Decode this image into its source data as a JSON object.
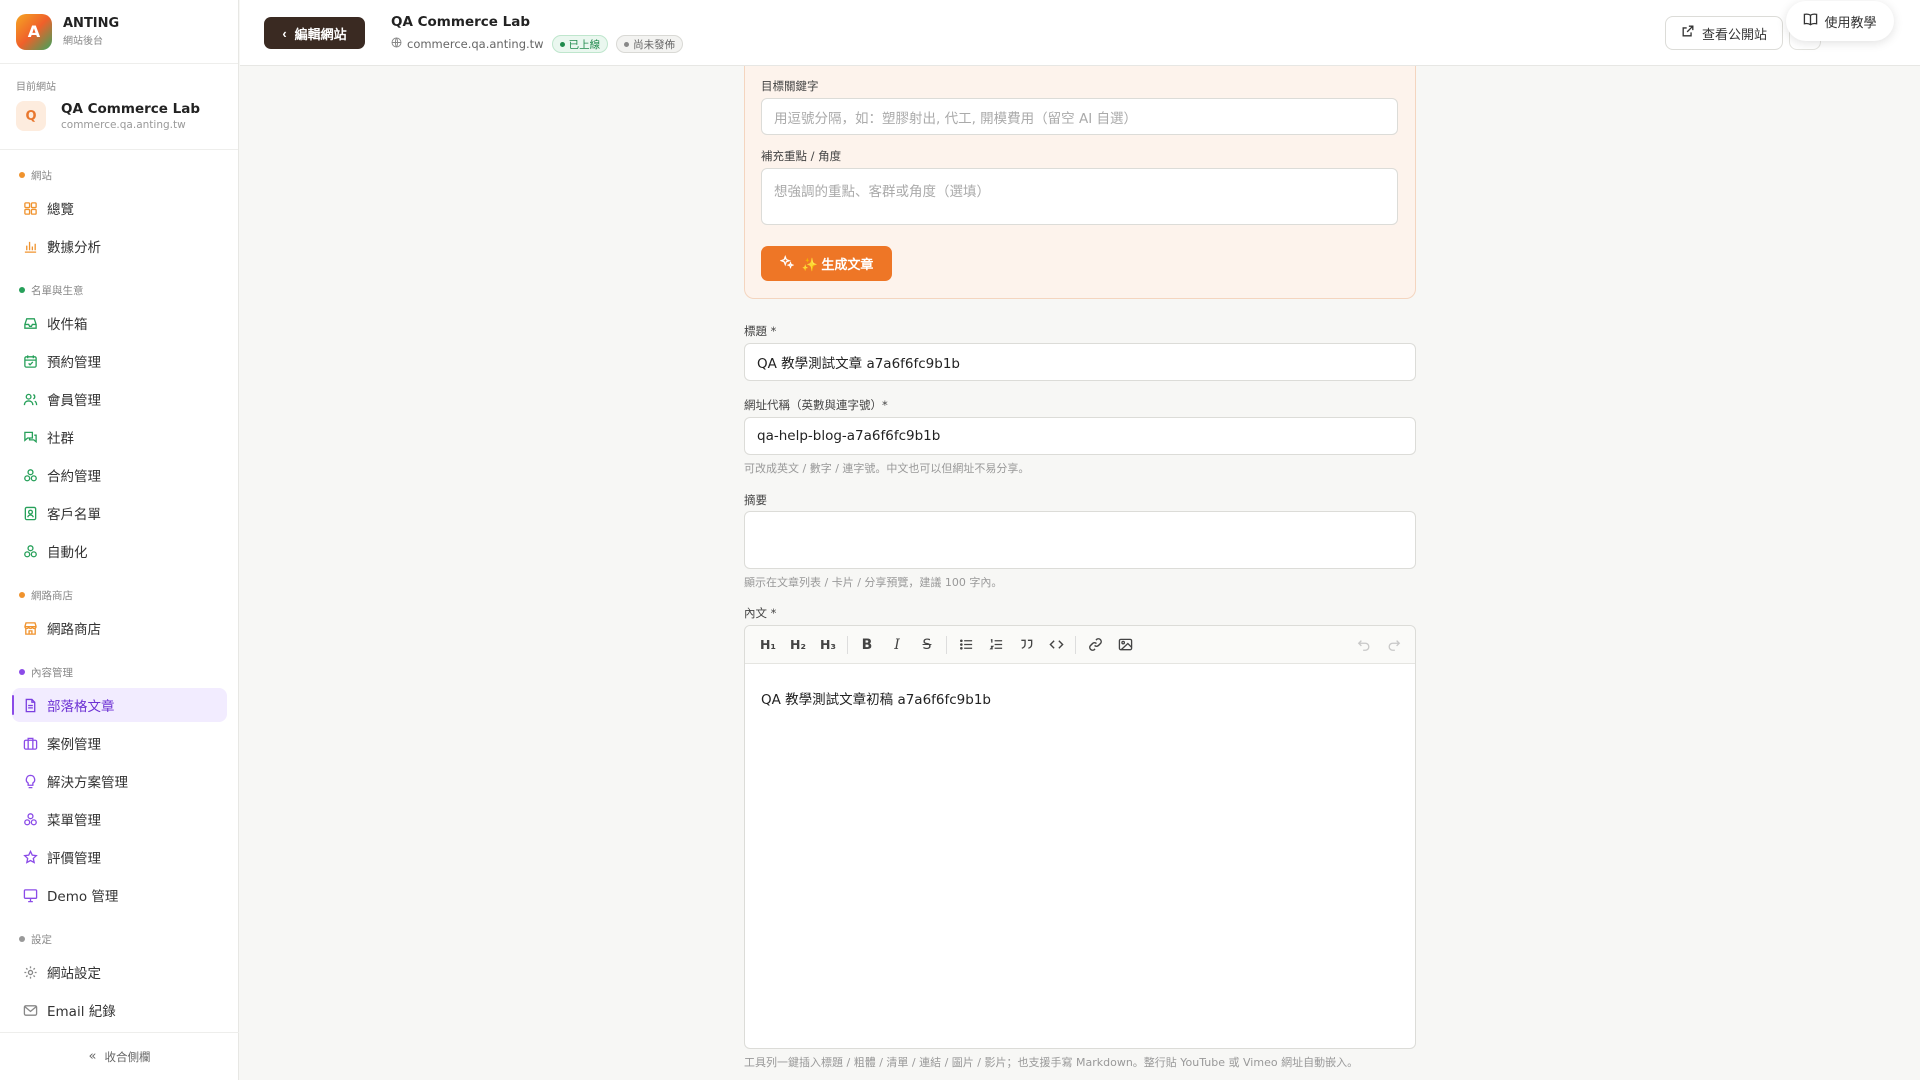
{
  "brand": {
    "name": "ANTING",
    "sub": "網站後台",
    "logo_letter": "A"
  },
  "current": {
    "label": "目前網站",
    "site_letter": "Q",
    "site_name": "QA Commerce Lab",
    "site_domain": "commerce.qa.anting.tw"
  },
  "nav": {
    "sec1": "網站",
    "sec1_color": "#f0932e",
    "overview": "總覽",
    "analytics": "數據分析",
    "sec2": "名單與生意",
    "sec2_color": "#27a05a",
    "inbox": "收件箱",
    "booking": "預約管理",
    "members": "會員管理",
    "community": "社群",
    "contracts": "合約管理",
    "customers": "客戶名單",
    "automation": "自動化",
    "sec3": "網路商店",
    "sec3_color": "#f0932e",
    "shop": "網路商店",
    "sec4": "內容管理",
    "sec4_color": "#8b4be8",
    "blog": "部落格文章",
    "cases": "案例管理",
    "solutions": "解決方案管理",
    "menu": "菜單管理",
    "reviews": "評價管理",
    "demo": "Demo 管理",
    "sec5": "設定",
    "sec5_color": "#999999",
    "settings": "網站設定",
    "email": "Email 紀錄",
    "collapse": "收合側欄"
  },
  "topbar": {
    "back": "編輯網站",
    "title": "QA Commerce Lab",
    "domain": "commerce.qa.anting.tw",
    "badge_live": "已上線",
    "badge_draft": "尚未發佈",
    "view_site": "查看公開站",
    "help": "使用教學"
  },
  "ai": {
    "keywords_label": "目標關鍵字",
    "keywords_placeholder": "用逗號分隔，如：塑膠射出, 代工, 開模費用（留空 AI 自選）",
    "focus_label": "補充重點 / 角度",
    "focus_placeholder": "想強調的重點、客群或角度（選填）",
    "generate": "✨ 生成文章"
  },
  "form": {
    "title_label": "標題 *",
    "title_value": "QA 教學測試文章 a7a6f6fc9b1b",
    "slug_label": "網址代稱（英數與連字號）*",
    "slug_value": "qa-help-blog-a7a6f6fc9b1b",
    "slug_hint": "可改成英文 / 數字 / 連字號。中文也可以但網址不易分享。",
    "summary_label": "摘要",
    "summary_value": "",
    "summary_hint": "顯示在文章列表 / 卡片 / 分享預覽，建議 100 字內。",
    "content_label": "內文 *",
    "content_value": "QA 教學測試文章初稿 a7a6f6fc9b1b",
    "content_hint": "工具列一鍵插入標題 / 粗體 / 清單 / 連結 / 圖片 / 影片；也支援手寫 Markdown。整行貼 YouTube 或 Vimeo 網址自動嵌入。"
  },
  "toolbar": {
    "h1": "H₁",
    "h2": "H₂",
    "h3": "H₃",
    "bold": "B",
    "italic": "I",
    "strike": "S"
  },
  "colors": {
    "accent": "#ee7626",
    "active": "#6d32d4",
    "back_btn": "#3a2a22"
  }
}
